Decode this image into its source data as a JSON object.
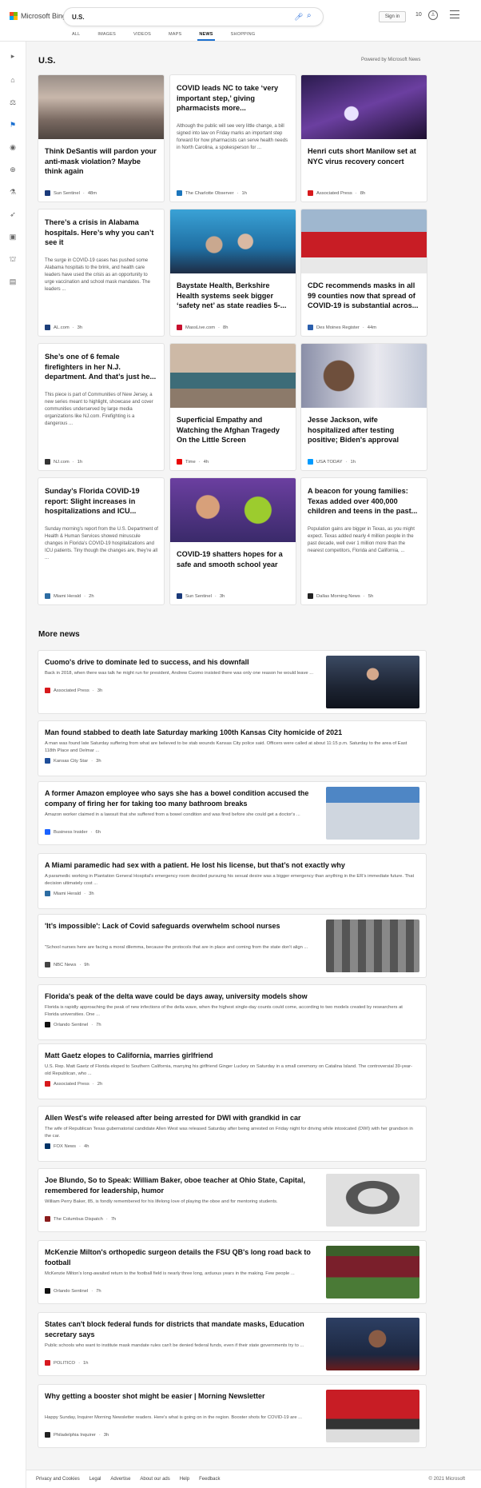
{
  "header": {
    "brand": "Microsoft Bing",
    "query": "U.S.",
    "signin_label": "Sign in",
    "points": "10",
    "tabs": [
      "ALL",
      "IMAGES",
      "VIDEOS",
      "MAPS",
      "NEWS",
      "SHOPPING"
    ],
    "active_tab": "NEWS",
    "accent": "#1a6fd0"
  },
  "rail_icons": [
    "expand-icon",
    "home-icon",
    "scale-icon",
    "flag-icon",
    "location-pin-icon",
    "globe-icon",
    "microscope-icon",
    "rocket-icon",
    "film-icon",
    "bank-icon",
    "ticket-icon"
  ],
  "section": {
    "title": "U.S.",
    "powered_by": "Powered by Microsoft News"
  },
  "cards": [
    {
      "title": "Think DeSantis will pardon your anti-mask violation? Maybe think again",
      "summary": "",
      "source": "Sun Sentinel",
      "time": "48m",
      "image": "mugshot-photo",
      "favicon_color": "#1a3a7a"
    },
    {
      "title": "COVID leads NC to take ‘very important step,’ giving pharmacists more...",
      "summary": "Although the public will see very little change, a bill signed into law on Friday marks an important step forward for how pharmacists can serve health needs in North Carolina, a spokesperson for ...",
      "source": "The Charlotte Observer",
      "time": "1h",
      "image": "",
      "favicon_color": "#1b75bc"
    },
    {
      "title": "Henri cuts short Manilow set at NYC virus recovery concert",
      "summary": "",
      "source": "Associated Press",
      "time": "8h",
      "image": "concert-photo",
      "favicon_color": "#d7191c"
    },
    {
      "title": "There’s a crisis in Alabama hospitals. Here’s why you can’t see it",
      "summary": "The surge in COVID-19 cases has pushed some Alabama hospitals to the brink, and health care leaders have used the crisis as an opportunity to urge vaccination and school mask mandates. The leaders ...",
      "source": "AL.com",
      "time": "3h",
      "image": "",
      "favicon_color": "#1e3f7a"
    },
    {
      "title": "Baystate Health, Berkshire Health systems seek bigger ‘safety net’ as state readies 5-...",
      "summary": "",
      "source": "MassLive.com",
      "time": "8h",
      "image": "press-conference-photo",
      "favicon_color": "#c8102e"
    },
    {
      "title": "CDC recommends masks in all 99 counties now that spread of COVID-19 is substantial acros...",
      "summary": "",
      "source": "Des Moines Register",
      "time": "44m",
      "image": "health-tent-photo",
      "favicon_color": "#2b5fad"
    },
    {
      "title": "She’s one of 6 female firefighters in her N.J. department. And that’s just he...",
      "summary": "This piece is part of Communities of New Jersey, a new series meant to highlight, showcase and cover communities underserved by large media organizations like NJ.com. Firefighting is a dangerous ...",
      "source": "NJ.com",
      "time": "1h",
      "image": "",
      "favicon_color": "#333333"
    },
    {
      "title": "Superficial Empathy and Watching the Afghan Tragedy On the Little Screen",
      "summary": "",
      "source": "Time",
      "time": "4h",
      "image": "living-room-photo",
      "favicon_color": "#e90606"
    },
    {
      "title": "Jesse Jackson, wife hospitalized after testing positive; Biden's approval dips...",
      "summary": "",
      "source": "USA TODAY",
      "time": "1h",
      "image": "vaccination-photo",
      "favicon_color": "#009bff"
    },
    {
      "title": "Sunday’s Florida COVID-19 report: Slight increases in hospitalizations and ICU...",
      "summary": "Sunday morning’s report from the U.S. Department of Health & Human Services showed minuscule changes in Florida’s COVID-19 hospitalizations and ICU patients. Tiny though the changes are, they’re all ...",
      "source": "Miami Herald",
      "time": "2h",
      "image": "",
      "favicon_color": "#2d6ca2"
    },
    {
      "title": "COVID-19 shatters hopes for a safe and smooth school year",
      "summary": "",
      "source": "Sun Sentinel",
      "time": "3h",
      "image": "kids-science-photo",
      "favicon_color": "#1a3a7a"
    },
    {
      "title": "A beacon for young families: Texas added over 400,000 children and teens in the past...",
      "summary": "Population gains are bigger in Texas, as you might expect. Texas added nearly 4 million people in the past decade, well over 1 million more than the nearest competitors, Florida and California, ...",
      "source": "Dallas Morning News",
      "time": "5h",
      "image": "",
      "favicon_color": "#222222"
    }
  ],
  "more_news": {
    "title": "More news",
    "items": [
      {
        "title": "Cuomo's drive to dominate led to success, and his downfall",
        "summary": "Back in 2018, when there was talk he might run for president, Andrew Cuomo insisted there was only one reason he would leave ...",
        "source": "Associated Press",
        "time": "3h",
        "image": "cuomo-photo",
        "favicon_color": "#d7191c"
      },
      {
        "title": "Man found stabbed to death late Saturday marking 100th Kansas City homicide of 2021",
        "summary": "A man was found late Saturday suffering from what are believed to be stab wounds Kansas City police said. Officers were called at about 11:15 p.m. Saturday to the area of East 118th Place and Delmar ...",
        "source": "Kansas City Star",
        "time": "3h",
        "image": "",
        "favicon_color": "#1f4e99"
      },
      {
        "title": "A former Amazon employee who says she has a bowel condition accused the company of firing her for taking too many bathroom breaks",
        "summary": "Amazon worker claimed in a lawsuit that she suffered from a bowel condition and was fired before she could get a doctor's ...",
        "source": "Business Insider",
        "time": "6h",
        "image": "amazon-sign-photo",
        "favicon_color": "#1a62ff"
      },
      {
        "title": "A Miami paramedic had sex with a patient. He lost his license, but that’s not exactly why",
        "summary": "A paramedic working in Plantation General Hospital’s emergency room decided pursuing his sexual desire was a bigger emergency than anything in the ER’s immediate future. That decision ultimately cost ...",
        "source": "Miami Herald",
        "time": "3h",
        "image": "",
        "favicon_color": "#2d6ca2"
      },
      {
        "title": "'It’s impossible': Lack of Covid safeguards overwhelm school nurses",
        "summary": "\"School nurses here are facing a moral dilemma, because the protocols that are in place and coming from the state don't align ...",
        "source": "NBC News",
        "time": "9h",
        "image": "classroom-photo",
        "favicon_color": "#444444"
      },
      {
        "title": "Florida's peak of the delta wave could be days away, university models show",
        "summary": "Florida is rapidly approaching the peak of new infections of the delta wave, when the highest single-day counts could come, according to two models created by researchers at Florida universities. One ...",
        "source": "Orlando Sentinel",
        "time": "7h",
        "image": "",
        "favicon_color": "#111111"
      },
      {
        "title": "Matt Gaetz elopes to California, marries girlfriend",
        "summary": "U.S. Rep. Matt Gaetz of Florida eloped to Southern California, marrying his girlfriend Ginger Luckey on Saturday in a small ceremony on Catalina Island. The controversial 39-year-old Republican, who ...",
        "source": "Associated Press",
        "time": "2h",
        "image": "",
        "favicon_color": "#d7191c"
      },
      {
        "title": "Allen West's wife released after being arrested for DWI with grandkid in car",
        "summary": "The wife of Republican Texas gubernatorial candidate Allen West was released Saturday after being arrested on Friday night for driving while intoxicated (DWI) with her grandson in the car.",
        "source": "FOX News",
        "time": "4h",
        "image": "",
        "favicon_color": "#003366"
      },
      {
        "title": "Joe Blundo, So to Speak: William Baker, oboe teacher at Ohio State, Capital, remembered for leadership, humor",
        "summary": "William Perry Baker, 85, is fondly remembered for his lifelong love of playing the oboe and for mentoring students.",
        "source": "The Columbus Dispatch",
        "time": "7h",
        "image": "portrait-photo",
        "favicon_color": "#8a1c1c"
      },
      {
        "title": "McKenzie Milton's orthopedic surgeon details the FSU QB's long road back to football",
        "summary": "McKenzie Milton's long-awaited return to the football field is nearly three long, arduous years in the making. Few people ...",
        "source": "Orlando Sentinel",
        "time": "7h",
        "image": "football-photo",
        "favicon_color": "#111111"
      },
      {
        "title": "States can't block federal funds for districts that mandate masks, Education secretary says",
        "summary": "Public schools who want to institute mask mandate rules can't be denied federal funds, even if their state governments try to ...",
        "source": "POLITICO",
        "time": "1h",
        "image": "education-secretary-photo",
        "favicon_color": "#d71920"
      },
      {
        "title": "Why getting a booster shot might be easier | Morning Newsletter",
        "summary": "Happy Sunday, Inquirer Morning Newsletter readers. Here’s what is going on in the region. Booster shots for COVID-19 are ...",
        "source": "Philadelphia Inquirer",
        "time": "3h",
        "image": "typewriter-photo",
        "favicon_color": "#222222"
      }
    ]
  },
  "footer": {
    "links": [
      "Privacy and Cookies",
      "Legal",
      "Advertise",
      "About our ads",
      "Help",
      "Feedback"
    ],
    "copyright": "© 2021 Microsoft"
  }
}
